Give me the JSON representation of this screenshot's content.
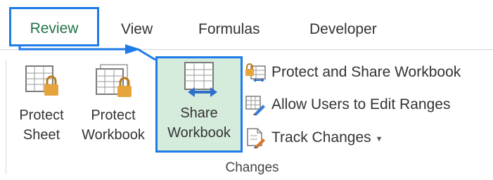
{
  "tabs": {
    "review": "Review",
    "view": "View",
    "formulas": "Formulas",
    "developer": "Developer"
  },
  "buttons": {
    "protect_sheet": [
      "Protect",
      "Sheet"
    ],
    "protect_workbook": [
      "Protect",
      "Workbook"
    ],
    "share_workbook": [
      "Share",
      "Workbook"
    ],
    "protect_and_share": "Protect and Share Workbook",
    "allow_users": "Allow Users to Edit Ranges",
    "track_changes": "Track Changes"
  },
  "group": {
    "label": "Changes"
  },
  "icons": {
    "protect_sheet": "sheet-lock-icon",
    "protect_workbook": "workbook-lock-icon",
    "share_workbook": "share-workbook-icon",
    "protect_and_share": "protect-share-icon",
    "allow_users": "edit-ranges-icon",
    "track_changes": "track-changes-icon"
  },
  "colors": {
    "highlight_border": "#1e7be8",
    "review_tab_text": "#217346",
    "share_bg": "#d5ebdc",
    "lock": "#e6a43c"
  }
}
